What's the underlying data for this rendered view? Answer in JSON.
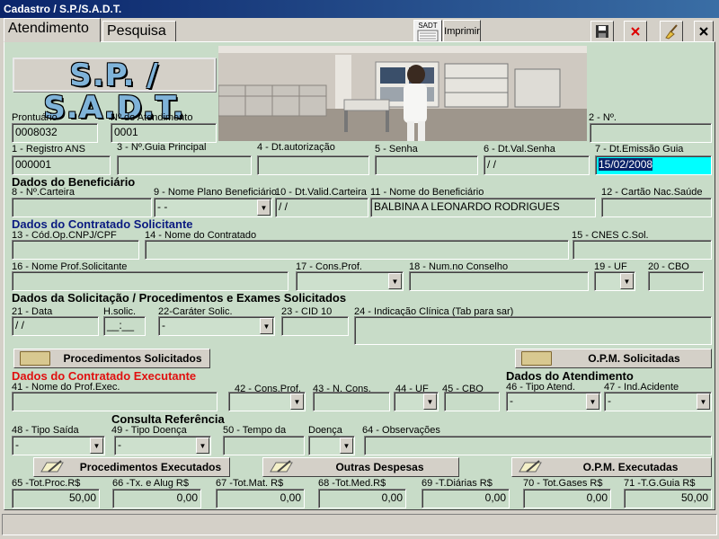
{
  "window": {
    "title": "Cadastro / S.P./S.A.D.T."
  },
  "tabs": [
    "Atendimento",
    "Pesquisa"
  ],
  "toolbar": {
    "print_label": "Imprimir",
    "sadt_icon_label": "SADT"
  },
  "header": {
    "logo_text": "S.P. / S.A.D.T."
  },
  "fields": {
    "prontuario": {
      "label": "Prontuário",
      "value": "0008032"
    },
    "num_atendimento": {
      "label": "Nº do Atendimento",
      "value": "0001"
    },
    "f2": {
      "label": "2 - Nº.",
      "value": ""
    },
    "f1": {
      "label": "1 - Registro ANS",
      "value": "000001"
    },
    "f3": {
      "label": "3 - Nº.Guia Principal",
      "value": ""
    },
    "f4": {
      "label": "4 - Dt.autorização",
      "value": ""
    },
    "f5": {
      "label": "5 - Senha",
      "value": ""
    },
    "f6": {
      "label": "6 - Dt.Val.Senha",
      "value": " / /"
    },
    "f7": {
      "label": "7 - Dt.Emissão Guia",
      "value": "15/02/2008"
    },
    "f8": {
      "label": "8 - Nº.Carteira",
      "value": ""
    },
    "f9": {
      "label": "9 - Nome Plano Beneficiário",
      "value": "- -"
    },
    "f10": {
      "label": "10 - Dt.Valid.Carteira",
      "value": " / /"
    },
    "f11": {
      "label": "11 - Nome do Beneficiário",
      "value": "BALBINA A LEONARDO RODRIGUES"
    },
    "f12": {
      "label": "12 - Cartão Nac.Saúde",
      "value": ""
    },
    "f13": {
      "label": "13 - Cód.Op.CNPJ/CPF",
      "value": ""
    },
    "f14": {
      "label": "14 - Nome do Contratado",
      "value": ""
    },
    "f15": {
      "label": "15 - CNES C.Sol.",
      "value": ""
    },
    "f16": {
      "label": "16 - Nome Prof.Solicitante",
      "value": ""
    },
    "f17": {
      "label": "17 - Cons.Prof.",
      "value": ""
    },
    "f18": {
      "label": "18 - Num.no Conselho",
      "value": ""
    },
    "f19": {
      "label": "19 - UF",
      "value": ""
    },
    "f20": {
      "label": "20 - CBO",
      "value": ""
    },
    "f21": {
      "label": "21 - Data",
      "value": " / /"
    },
    "hsolic": {
      "label": "H.solic.",
      "value": "__:__"
    },
    "f22": {
      "label": "22-Caráter  Solic.",
      "value": "-"
    },
    "f23": {
      "label": "23 - CID 10",
      "value": ""
    },
    "f24": {
      "label": "24 - Indicação Clínica (Tab para sar)",
      "value": ""
    },
    "f41": {
      "label": "41 - Nome do Prof.Exec.",
      "value": ""
    },
    "f42": {
      "label": "42 - Cons.Prof.",
      "value": ""
    },
    "f43": {
      "label": "43 - N. Cons.",
      "value": ""
    },
    "f44": {
      "label": "44 - UF",
      "value": ""
    },
    "f45": {
      "label": "45 - CBO",
      "value": ""
    },
    "f46": {
      "label": "46 - Tipo Atend.",
      "value": "-"
    },
    "f47": {
      "label": "47 - Ind.Acidente",
      "value": "-"
    },
    "f48": {
      "label": "48 - Tipo Saída",
      "value": "-"
    },
    "f49": {
      "label": "49 - Tipo Doença",
      "value": "-"
    },
    "f50": {
      "label": "50 - Tempo da",
      "value": ""
    },
    "doenca": {
      "label": "Doença",
      "value": ""
    },
    "f64": {
      "label": "64 - Observações",
      "value": ""
    },
    "f65": {
      "label": "65 -Tot.Proc.R$",
      "value": "50,00"
    },
    "f66": {
      "label": "66 -Tx. e Alug R$",
      "value": "0,00"
    },
    "f67": {
      "label": "67 -Tot.Mat. R$",
      "value": "0,00"
    },
    "f68": {
      "label": "68 -Tot.Med.R$",
      "value": "0,00"
    },
    "f69": {
      "label": "69 -T.Diárias R$",
      "value": "0,00"
    },
    "f70": {
      "label": "70 - Tot.Gases R$",
      "value": "0,00"
    },
    "f71": {
      "label": "71 -T.G.Guia R$",
      "value": "50,00"
    }
  },
  "sections": {
    "beneficiario": "Dados do Beneficiário",
    "contratado_sol": "Dados do Contratado Solicitante",
    "solicitacao": "Dados da Solicitação / Procedimentos e Exames Solicitados",
    "contratado_exec": "Dados do Contratado Executante",
    "atendimento": "Dados do Atendimento",
    "consulta_ref": "Consulta Referência"
  },
  "buttons": {
    "proc_solicitados": "Procedimentos Solicitados",
    "opm_solicitadas": "O.P.M. Solicitadas",
    "proc_executados": "Procedimentos Executados",
    "outras_despesas": "Outras Despesas",
    "opm_executadas": "O.P.M. Executadas"
  },
  "colors": {
    "panel_bg": "#c8dcc8",
    "title_blue": "#0a1a80",
    "title_red": "#e01010",
    "highlight": "#00ffff"
  }
}
